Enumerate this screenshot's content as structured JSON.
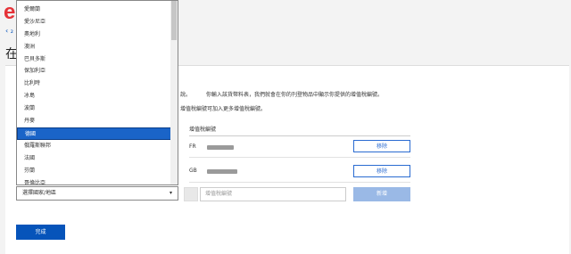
{
  "header": {
    "logo": "e",
    "back": "‹ ₂",
    "page_title": "在"
  },
  "description": {
    "line1a": "說。",
    "line1b": "你輸入該貨幣料表，我們就會在你的刊登物品中顯示你提供的增值稅編號。",
    "line2": "增值稅編號可加入更多增值稅編號。"
  },
  "vat_table": {
    "header": "增值稅編號",
    "rows": [
      {
        "country_code": "FR",
        "remove_label": "移除"
      },
      {
        "country_code": "GB",
        "remove_label": "移除"
      }
    ],
    "add_input_placeholder": "增值稅編號",
    "add_button_label": "新增"
  },
  "country_select": {
    "placeholder": "選擇國家/地區",
    "arrow": "▾"
  },
  "done_button_label": "完成",
  "dropdown": {
    "options": [
      "□□",
      "愛爾蘭",
      "愛沙尼亞",
      "奧地利",
      "澳洲",
      "巴貝多斯",
      "保加利亞",
      "比利時",
      "冰島",
      "波蘭",
      "丹麥",
      "德國",
      "俄羅斯聯邦",
      "法國",
      "芬蘭",
      "哥倫比亞"
    ],
    "selected_index": 11
  },
  "colors": {
    "accent": "#0654ba",
    "logo": "#e53238",
    "selected_option": "#1a64c8",
    "disabled_button": "#9ab9e6"
  }
}
